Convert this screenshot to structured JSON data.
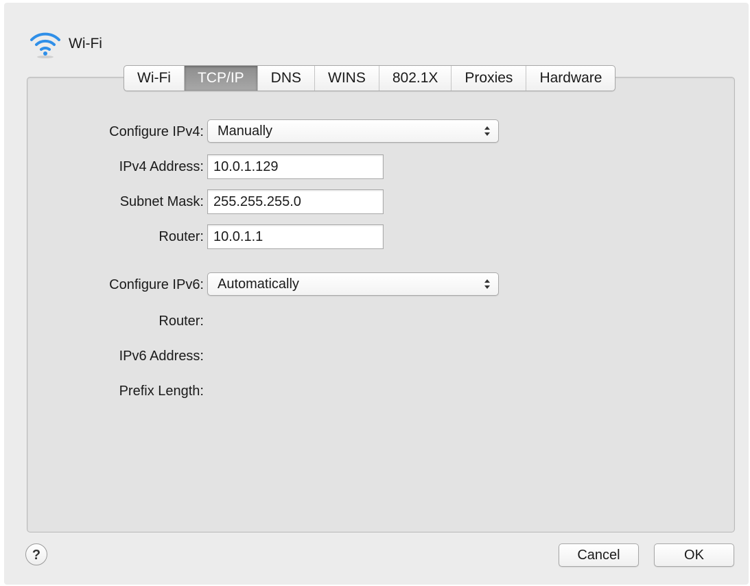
{
  "window": {
    "title": "Wi-Fi",
    "icon": "wifi-icon"
  },
  "tabs": [
    {
      "label": "Wi-Fi",
      "selected": false
    },
    {
      "label": "TCP/IP",
      "selected": true
    },
    {
      "label": "DNS",
      "selected": false
    },
    {
      "label": "WINS",
      "selected": false
    },
    {
      "label": "802.1X",
      "selected": false
    },
    {
      "label": "Proxies",
      "selected": false
    },
    {
      "label": "Hardware",
      "selected": false
    }
  ],
  "ipv4": {
    "configure_label": "Configure IPv4:",
    "configure_value": "Manually",
    "address_label": "IPv4 Address:",
    "address_value": "10.0.1.129",
    "subnet_label": "Subnet Mask:",
    "subnet_value": "255.255.255.0",
    "router_label": "Router:",
    "router_value": "10.0.1.1"
  },
  "ipv6": {
    "configure_label": "Configure IPv6:",
    "configure_value": "Automatically",
    "router_label": "Router:",
    "address_label": "IPv6 Address:",
    "prefix_label": "Prefix Length:"
  },
  "buttons": {
    "help": "?",
    "cancel": "Cancel",
    "ok": "OK"
  },
  "colors": {
    "wifi_blue": "#2f8fe8",
    "selected_tab": "#9a9a9a"
  }
}
